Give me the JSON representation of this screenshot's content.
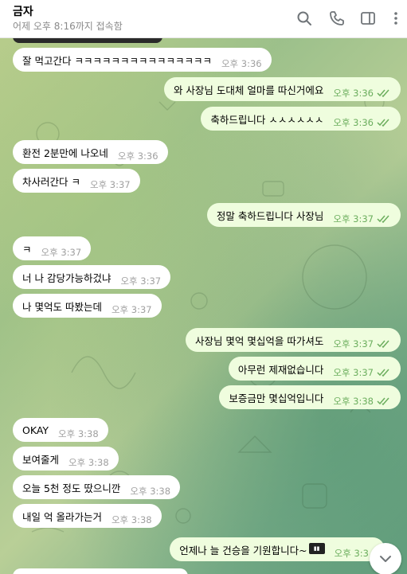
{
  "header": {
    "title": "금자",
    "status": "어제 오후 8:16까지 접속함",
    "icons": [
      "search-icon",
      "phone-icon",
      "sidebar-toggle-icon",
      "more-vertical-icon"
    ]
  },
  "messages": [
    {
      "dir": "in",
      "text": "잘 먹고간다 ㅋㅋㅋㅋㅋㅋㅋㅋㅋㅋㅋㅋㅋㅋㅋ",
      "time": "오후 3:36"
    },
    {
      "dir": "out",
      "text": "와 사장님 도대체 얼마를 따신거에요",
      "time": "오후 3:36"
    },
    {
      "dir": "out",
      "text": "축하드립니다 ㅅㅅㅅㅅㅅㅅ",
      "time": "오후 3:36"
    },
    {
      "dir": "in",
      "text": "환전 2분만에 나오네",
      "time": "오후 3:36"
    },
    {
      "dir": "in",
      "text": "차사러간다 ㅋ",
      "time": "오후 3:37"
    },
    {
      "dir": "out",
      "text": "정말 축하드립니다 사장님",
      "time": "오후 3:37"
    },
    {
      "dir": "in",
      "text": "ㅋ",
      "time": "오후 3:37"
    },
    {
      "dir": "in",
      "text": "너 나 감당가능하겄냐",
      "time": "오후 3:37"
    },
    {
      "dir": "in",
      "text": "나 몇억도 따봤는데",
      "time": "오후 3:37"
    },
    {
      "dir": "out",
      "text": "사장님 몇억 몇십억을 따가셔도",
      "time": "오후 3:37"
    },
    {
      "dir": "out",
      "text": "아무런 제재없습니다",
      "time": "오후 3:37"
    },
    {
      "dir": "out",
      "text": "보증금만 몇십억입니다",
      "time": "오후 3:38"
    },
    {
      "dir": "in",
      "text": "OKAY",
      "time": "오후 3:38"
    },
    {
      "dir": "in",
      "text": "보여줄게",
      "time": "오후 3:38"
    },
    {
      "dir": "in",
      "text": "오늘 5천 정도 땄으니깐",
      "time": "오후 3:38"
    },
    {
      "dir": "in",
      "text": "내일 억 올라가는거",
      "time": "오후 3:38"
    },
    {
      "dir": "out",
      "text": "언제나 늘 건승을 기원합니다~",
      "time": "오후 3:3"
    }
  ],
  "colors": {
    "incoming_bubble": "#ffffff",
    "outgoing_bubble": "#effdde",
    "outgoing_time": "#6cae5e",
    "incoming_time": "#a0a0a0"
  },
  "scroll_button_icon": "chevron-down-icon"
}
